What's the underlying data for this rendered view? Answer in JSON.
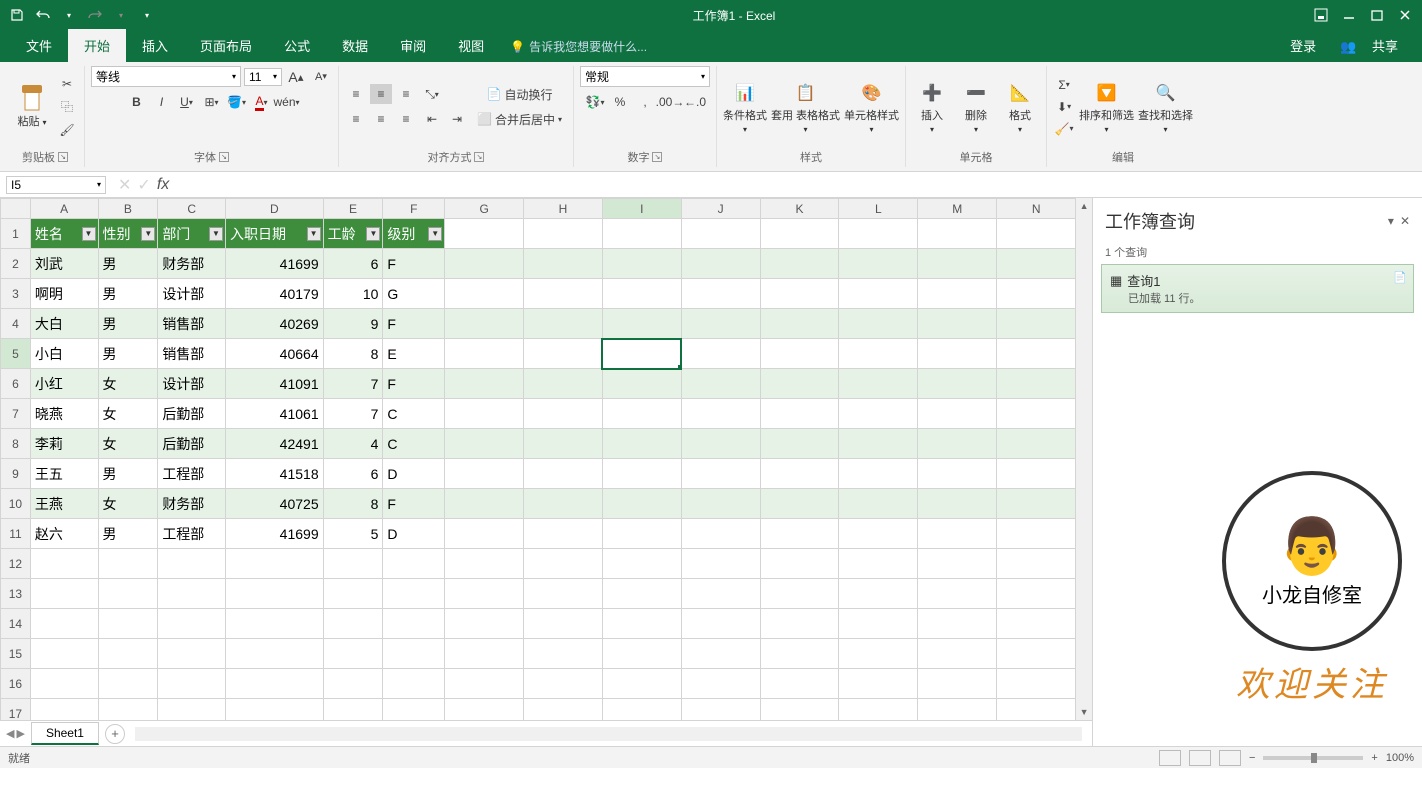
{
  "title": "工作簿1 - Excel",
  "tabs": [
    "文件",
    "开始",
    "插入",
    "页面布局",
    "公式",
    "数据",
    "审阅",
    "视图"
  ],
  "active_tab": "开始",
  "tellme": "告诉我您想要做什么...",
  "login": "登录",
  "share": "共享",
  "ribbon": {
    "clipboard": {
      "paste": "粘贴",
      "label": "剪贴板"
    },
    "font": {
      "name": "等线",
      "size": "11",
      "label": "字体"
    },
    "align": {
      "wrap": "自动换行",
      "merge": "合并后居中",
      "label": "对齐方式"
    },
    "number": {
      "format": "常规",
      "label": "数字"
    },
    "styles": {
      "cond": "条件格式",
      "table": "套用\n表格格式",
      "cell": "单元格样式",
      "label": "样式"
    },
    "cells": {
      "insert": "插入",
      "delete": "删除",
      "format": "格式",
      "label": "单元格"
    },
    "editing": {
      "sort": "排序和筛选",
      "find": "查找和选择",
      "label": "编辑"
    }
  },
  "namebox": "I5",
  "columns": [
    "A",
    "B",
    "C",
    "D",
    "E",
    "F",
    "G",
    "H",
    "I",
    "J",
    "K",
    "L",
    "M",
    "N"
  ],
  "headers": [
    "姓名",
    "性别",
    "部门",
    "入职日期",
    "工龄",
    "级别"
  ],
  "rows": [
    {
      "n": "刘武",
      "s": "男",
      "d": "财务部",
      "date": "41699",
      "y": "6",
      "l": "F"
    },
    {
      "n": "啊明",
      "s": "男",
      "d": "设计部",
      "date": "40179",
      "y": "10",
      "l": "G"
    },
    {
      "n": "大白",
      "s": "男",
      "d": "销售部",
      "date": "40269",
      "y": "9",
      "l": "F"
    },
    {
      "n": "小白",
      "s": "男",
      "d": "销售部",
      "date": "40664",
      "y": "8",
      "l": "E"
    },
    {
      "n": "小红",
      "s": "女",
      "d": "设计部",
      "date": "41091",
      "y": "7",
      "l": "F"
    },
    {
      "n": "晓燕",
      "s": "女",
      "d": "后勤部",
      "date": "41061",
      "y": "7",
      "l": "C"
    },
    {
      "n": "李莉",
      "s": "女",
      "d": "后勤部",
      "date": "42491",
      "y": "4",
      "l": "C"
    },
    {
      "n": "王五",
      "s": "男",
      "d": "工程部",
      "date": "41518",
      "y": "6",
      "l": "D"
    },
    {
      "n": "王燕",
      "s": "女",
      "d": "财务部",
      "date": "40725",
      "y": "8",
      "l": "F"
    },
    {
      "n": "赵六",
      "s": "男",
      "d": "工程部",
      "date": "41699",
      "y": "5",
      "l": "D"
    }
  ],
  "visible_rows": 18,
  "selected_cell": {
    "row": 5,
    "col": "I"
  },
  "pane": {
    "title": "工作簿查询",
    "count": "1 个查询",
    "query_name": "查询1",
    "status": "已加载 11 行。"
  },
  "sheet_tab": "Sheet1",
  "status": "就绪",
  "zoom": "100%",
  "logo_text": "小龙自修室",
  "welcome": "欢迎关注"
}
